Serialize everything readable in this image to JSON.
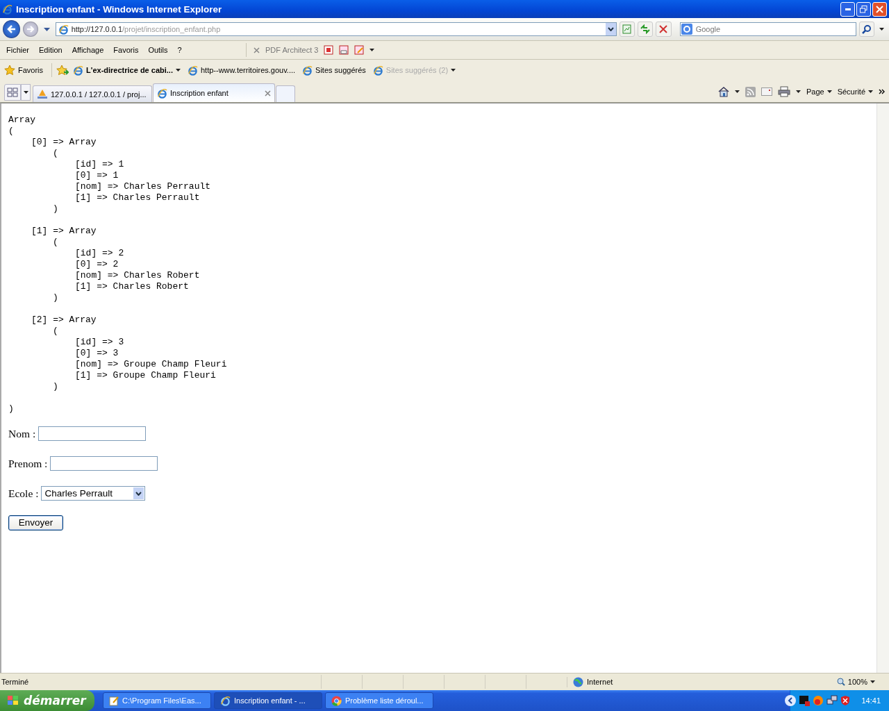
{
  "window": {
    "title": "Inscription enfant - Windows Internet Explorer"
  },
  "address_bar": {
    "url_host": "http://127.0.0.1",
    "url_path": "/projet/inscription_enfant.php",
    "search_placeholder": "Google"
  },
  "menu": [
    "Fichier",
    "Edition",
    "Affichage",
    "Favoris",
    "Outils",
    "?"
  ],
  "pdf_toolbar": {
    "label": "PDF Architect 3"
  },
  "favorites_bar": {
    "label": "Favoris",
    "items": [
      {
        "label": "L'ex-directrice de cabi...",
        "bold": true,
        "dropdown": true,
        "disabled": false
      },
      {
        "label": "http--www.territoires.gouv....",
        "bold": false,
        "dropdown": false,
        "disabled": false
      },
      {
        "label": "Sites suggérés",
        "bold": false,
        "dropdown": false,
        "disabled": false
      },
      {
        "label": "Sites suggérés (2)",
        "bold": false,
        "dropdown": true,
        "disabled": true
      }
    ]
  },
  "tabs": [
    {
      "label": "127.0.0.1 / 127.0.0.1 / proj...",
      "selected": false,
      "kind": "pma"
    },
    {
      "label": "Inscription enfant",
      "selected": true,
      "kind": "ie"
    }
  ],
  "command_bar": [
    "Page",
    "Sécurité"
  ],
  "dump": {
    "header": "Array",
    "open": "(",
    "close": ")",
    "entries": [
      {
        "key": "[0] => Array",
        "open": "(",
        "lines": [
          "[id] => 1",
          "[0] => 1",
          "[nom] => Charles Perrault",
          "[1] => Charles Perrault"
        ],
        "close": ")"
      },
      {
        "key": "[1] => Array",
        "open": "(",
        "lines": [
          "[id] => 2",
          "[0] => 2",
          "[nom] => Charles Robert",
          "[1] => Charles Robert"
        ],
        "close": ")"
      },
      {
        "key": "[2] => Array",
        "open": "(",
        "lines": [
          "[id] => 3",
          "[0] => 3",
          "[nom] => Groupe Champ Fleuri",
          "[1] => Groupe Champ Fleuri"
        ],
        "close": ")"
      }
    ]
  },
  "form": {
    "fields": [
      {
        "label": "Nom :",
        "kind": "text"
      },
      {
        "label": "Prenom :",
        "kind": "text"
      },
      {
        "label": "Ecole :",
        "kind": "select",
        "value": "Charles Perrault"
      }
    ],
    "submit": "Envoyer"
  },
  "status_bar": {
    "text": "Terminé",
    "zone": "Internet",
    "zoom": "100%"
  },
  "taskbar": {
    "start": "démarrer",
    "items": [
      {
        "label": "C:\\Program Files\\Eas...",
        "selected": false,
        "kind": "notepad"
      },
      {
        "label": "Inscription enfant - ...",
        "selected": true,
        "kind": "ie"
      },
      {
        "label": "Problème liste déroul...",
        "selected": false,
        "kind": "chrome"
      }
    ],
    "clock": "14:41"
  }
}
